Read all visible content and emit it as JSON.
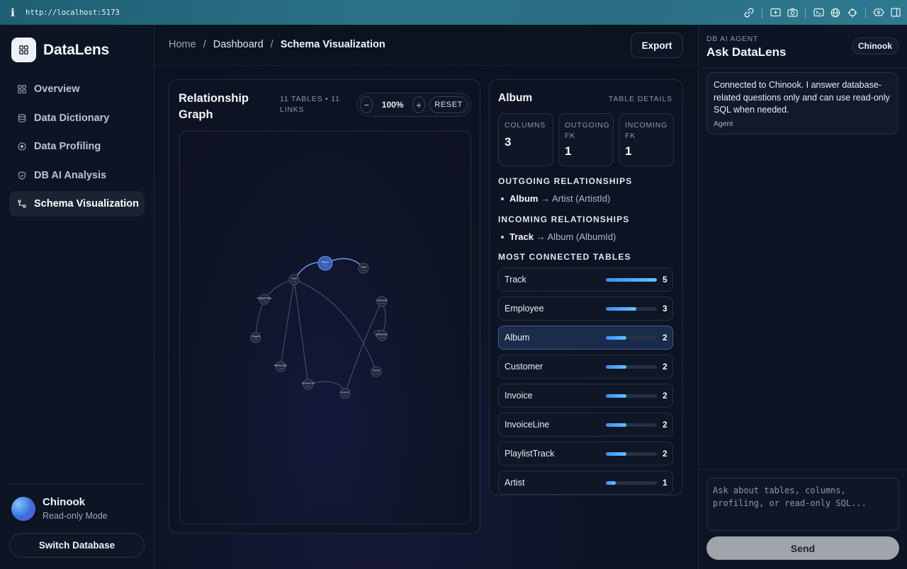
{
  "browser": {
    "url": "http://localhost:5173"
  },
  "brand": {
    "name": "DataLens"
  },
  "nav": [
    {
      "label": "Overview",
      "icon": "grid-icon",
      "active": false
    },
    {
      "label": "Data Dictionary",
      "icon": "database-icon",
      "active": false
    },
    {
      "label": "Data Profiling",
      "icon": "target-icon",
      "active": false
    },
    {
      "label": "DB AI Analysis",
      "icon": "shield-icon",
      "active": false
    },
    {
      "label": "Schema Visualization",
      "icon": "schema-icon",
      "active": true
    }
  ],
  "database": {
    "name": "Chinook",
    "mode": "Read-only Mode",
    "switch_label": "Switch Database"
  },
  "breadcrumb": {
    "home": "Home",
    "sep": "/",
    "mid": "Dashboard",
    "current": "Schema Visualization"
  },
  "header": {
    "export_label": "Export"
  },
  "graph": {
    "title": "Relationship Graph",
    "meta": "11 TABLES • 11 LINKS",
    "zoom_out": "−",
    "zoom_level": "100%",
    "zoom_in": "+",
    "reset": "RESET",
    "nodes": [
      {
        "id": "Album",
        "sub": "3 cols",
        "selected": true
      },
      {
        "id": "Artist",
        "sub": "2 cols"
      },
      {
        "id": "Track",
        "sub": "9 cols"
      },
      {
        "id": "PlaylistTrack",
        "sub": "2 cols"
      },
      {
        "id": "Customer",
        "sub": "13 cols"
      },
      {
        "id": "Employee",
        "sub": "15 cols"
      },
      {
        "id": "Playlist",
        "sub": "2 cols"
      },
      {
        "id": "MediaType",
        "sub": "2 cols"
      },
      {
        "id": "Genre",
        "sub": "2 cols"
      },
      {
        "id": "InvoiceLine",
        "sub": "5 cols"
      },
      {
        "id": "Invoice",
        "sub": "9 cols"
      }
    ]
  },
  "details": {
    "table": "Album",
    "kicker": "TABLE DETAILS",
    "stats": [
      {
        "label": "COLUMNS",
        "value": "3"
      },
      {
        "label": "OUTGOING FK",
        "value": "1"
      },
      {
        "label": "INCOMING FK",
        "value": "1"
      }
    ],
    "outgoing_heading": "OUTGOING RELATIONSHIPS",
    "outgoing": {
      "from": "Album",
      "arrow": "→",
      "to": "Artist (ArtistId)"
    },
    "incoming_heading": "INCOMING RELATIONSHIPS",
    "incoming": {
      "from": "Track",
      "arrow": "→",
      "to": "Album (AlbumId)"
    },
    "connected_heading": "MOST CONNECTED TABLES",
    "connected": [
      {
        "name": "Track",
        "count": 5,
        "selected": false
      },
      {
        "name": "Employee",
        "count": 3,
        "selected": false
      },
      {
        "name": "Album",
        "count": 2,
        "selected": true
      },
      {
        "name": "Customer",
        "count": 2,
        "selected": false
      },
      {
        "name": "Invoice",
        "count": 2,
        "selected": false
      },
      {
        "name": "InvoiceLine",
        "count": 2,
        "selected": false
      },
      {
        "name": "PlaylistTrack",
        "count": 2,
        "selected": false
      },
      {
        "name": "Artist",
        "count": 1,
        "selected": false
      }
    ]
  },
  "agent": {
    "kicker": "DB AI AGENT",
    "title": "Ask DataLens",
    "db_pill": "Chinook",
    "message": "Connected to Chinook. I answer database-related questions only and can use read-only SQL when needed.",
    "message_author": "Agent",
    "input_placeholder": "Ask about tables, columns, profiling, or read-only SQL...",
    "send_label": "Send"
  },
  "colors": {
    "accent": "#3f8cff",
    "accent_light": "#5fc6ff",
    "selected_row": "#1a2b4c"
  }
}
